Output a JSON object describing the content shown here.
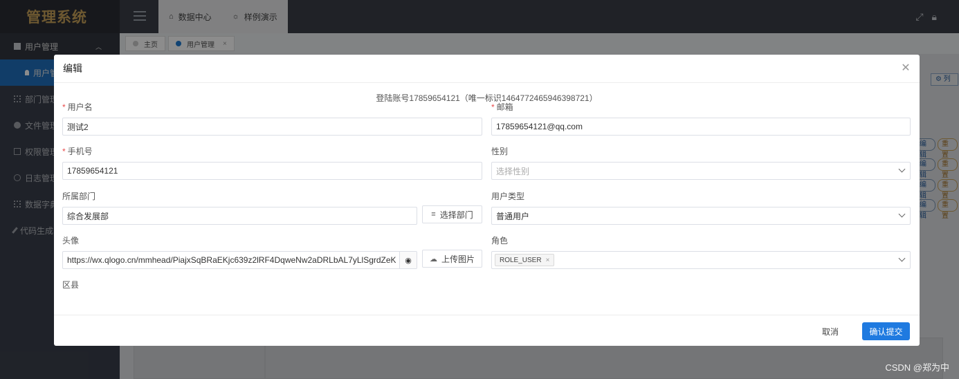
{
  "app": {
    "logo": "管理系统"
  },
  "sidebar": {
    "items": [
      {
        "label": "用户管理",
        "icon": "user-square-icon",
        "state": "open"
      },
      {
        "label": "用户管",
        "icon": "person-icon",
        "state": "active-sub"
      },
      {
        "label": "部门管理",
        "icon": "grid-icon"
      },
      {
        "label": "文件管理",
        "icon": "folder-icon"
      },
      {
        "label": "权限管理",
        "icon": "monitor-icon"
      },
      {
        "label": "日志管理",
        "icon": "clock-icon"
      },
      {
        "label": "数据字典",
        "icon": "grid-icon"
      },
      {
        "label": "代码生成",
        "icon": "pen-icon"
      }
    ]
  },
  "topbar": {
    "tabs": [
      {
        "label": "数据中心",
        "icon": "home-icon"
      },
      {
        "label": "样例演示",
        "icon": "bulb-icon"
      }
    ]
  },
  "tagbar": {
    "tags": [
      {
        "label": "主页"
      },
      {
        "label": "用户管理",
        "active": true
      }
    ]
  },
  "background": {
    "column_button": "列",
    "row_edit": "编辑",
    "row_reset": "重置"
  },
  "modal": {
    "title": "编辑",
    "account_info": "登陆账号17859654121（唯一标识1464772465946398721）",
    "fields": {
      "username": {
        "label": "用户名",
        "required": true,
        "value": "测试2"
      },
      "email": {
        "label": "邮箱",
        "required": true,
        "value": "17859654121@qq.com"
      },
      "phone": {
        "label": "手机号",
        "required": true,
        "value": "17859654121"
      },
      "gender": {
        "label": "性别",
        "placeholder": "选择性别"
      },
      "department": {
        "label": "所属部门",
        "value": "综合发展部",
        "button": "选择部门"
      },
      "user_type": {
        "label": "用户类型",
        "value": "普通用户"
      },
      "avatar": {
        "label": "头像",
        "value": "https://wx.qlogo.cn/mmhead/PiajxSqBRaEKjc639z2lRF4DqweNw2aDRLbAL7yLlSgrdZeKBCwLH",
        "button": "上传图片"
      },
      "role": {
        "label": "角色",
        "chips": [
          "ROLE_USER"
        ]
      },
      "district": {
        "label": "区县"
      }
    },
    "footer": {
      "cancel": "取消",
      "submit": "确认提交"
    }
  },
  "watermark": "CSDN @郑为中",
  "colors": {
    "primary": "#1f7ae0",
    "sidebar_active": "#1f6fbd",
    "required": "#e94b4b",
    "logo": "#c8a25a"
  }
}
